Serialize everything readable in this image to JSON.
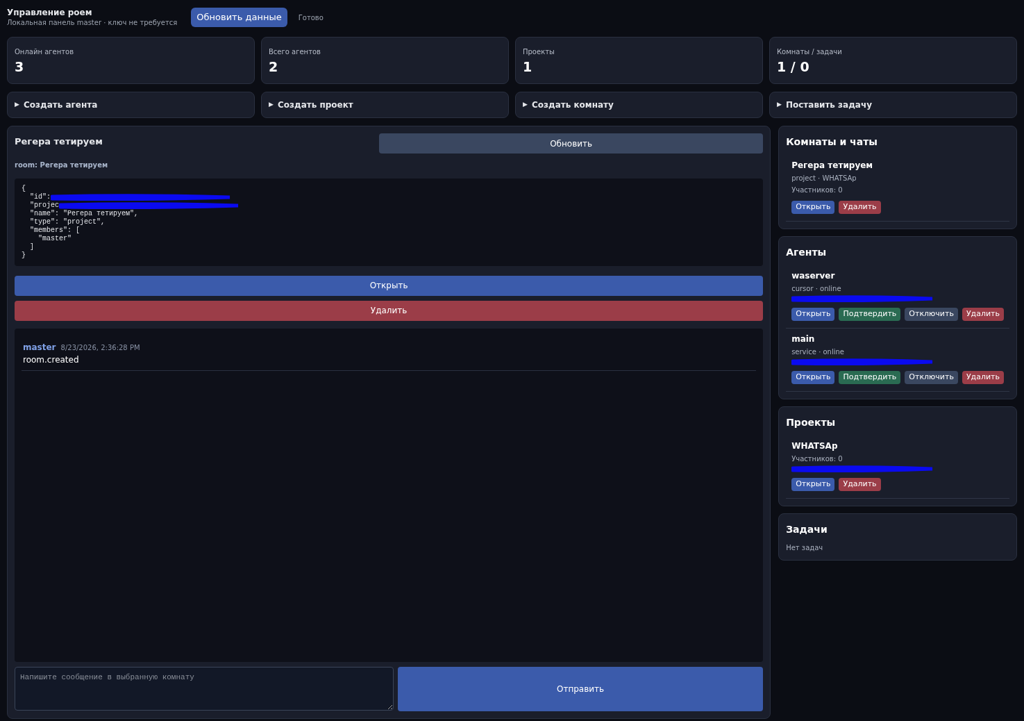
{
  "header": {
    "title": "Управление роем",
    "subtitle": "Локальная панель master · ключ не требуется",
    "refresh_button": "Обновить данные",
    "status": "Готово"
  },
  "stats": [
    {
      "label": "Онлайн агентов",
      "value": "3"
    },
    {
      "label": "Всего агентов",
      "value": "2"
    },
    {
      "label": "Проекты",
      "value": "1"
    },
    {
      "label": "Комнаты / задачи",
      "value": "1 / 0"
    }
  ],
  "actions": [
    {
      "marker": "▶",
      "label": "Создать агента",
      "expanded": false
    },
    {
      "marker": "▶",
      "label": "Создать проект",
      "expanded": false
    },
    {
      "marker": "▶",
      "label": "Создать комнату",
      "expanded": false
    },
    {
      "marker": "▶",
      "label": "Поставить задачу",
      "expanded": false
    }
  ],
  "room_view": {
    "title": "Регера тетируем",
    "refresh_button": "Обновить",
    "subtitle": "room: Регера тетируем",
    "json_lines": [
      {
        "text": "{",
        "redacted": false
      },
      {
        "text": "  \"id\":",
        "redacted": true
      },
      {
        "text": "  \"projec",
        "redacted": true
      },
      {
        "text": "  \"name\": \"Регера тетируем\",",
        "redacted": false
      },
      {
        "text": "  \"type\": \"project\",",
        "redacted": false
      },
      {
        "text": "  \"members\": [",
        "redacted": false
      },
      {
        "text": "    \"master\"",
        "redacted": false
      },
      {
        "text": "  ]",
        "redacted": false
      },
      {
        "text": "}",
        "redacted": false
      }
    ],
    "open_button": "Открыть",
    "delete_button": "Удалить",
    "messages": [
      {
        "author": "master",
        "time": "8/23/2026, 2:36:28 PM",
        "text": "room.created"
      }
    ],
    "message_input": {
      "placeholder": "Напишите сообщение в выбранную комнату"
    },
    "send_button": "Отправить"
  },
  "rooms": {
    "title": "Комнаты и чаты",
    "items": [
      {
        "name": "Регера тетируем",
        "lines": [
          "project · WHATSAp",
          "Участников: 0"
        ],
        "redacted": false,
        "buttons": [
          {
            "kind": "open",
            "label": "Открыть"
          },
          {
            "kind": "delete",
            "label": "Удалить"
          }
        ]
      }
    ]
  },
  "agents": {
    "title": "Агенты",
    "items": [
      {
        "name": "waserver",
        "lines": [
          "cursor · online"
        ],
        "redacted": true,
        "buttons": [
          {
            "kind": "open",
            "label": "Открыть"
          },
          {
            "kind": "confirm",
            "label": "Подтвердить"
          },
          {
            "kind": "disable",
            "label": "Отключить"
          },
          {
            "kind": "delete",
            "label": "Удалить"
          }
        ]
      },
      {
        "name": "main",
        "lines": [
          "service · online"
        ],
        "redacted": true,
        "buttons": [
          {
            "kind": "open",
            "label": "Открыть"
          },
          {
            "kind": "confirm",
            "label": "Подтвердить"
          },
          {
            "kind": "disable",
            "label": "Отключить"
          },
          {
            "kind": "delete",
            "label": "Удалить"
          }
        ]
      }
    ]
  },
  "projects": {
    "title": "Проекты",
    "items": [
      {
        "name": "WHATSAp",
        "lines": [
          "Участников: 0"
        ],
        "redacted": true,
        "buttons": [
          {
            "kind": "open",
            "label": "Открыть"
          },
          {
            "kind": "delete",
            "label": "Удалить"
          }
        ]
      }
    ]
  },
  "tasks": {
    "title": "Задачи",
    "empty_text": "Нет задач"
  }
}
